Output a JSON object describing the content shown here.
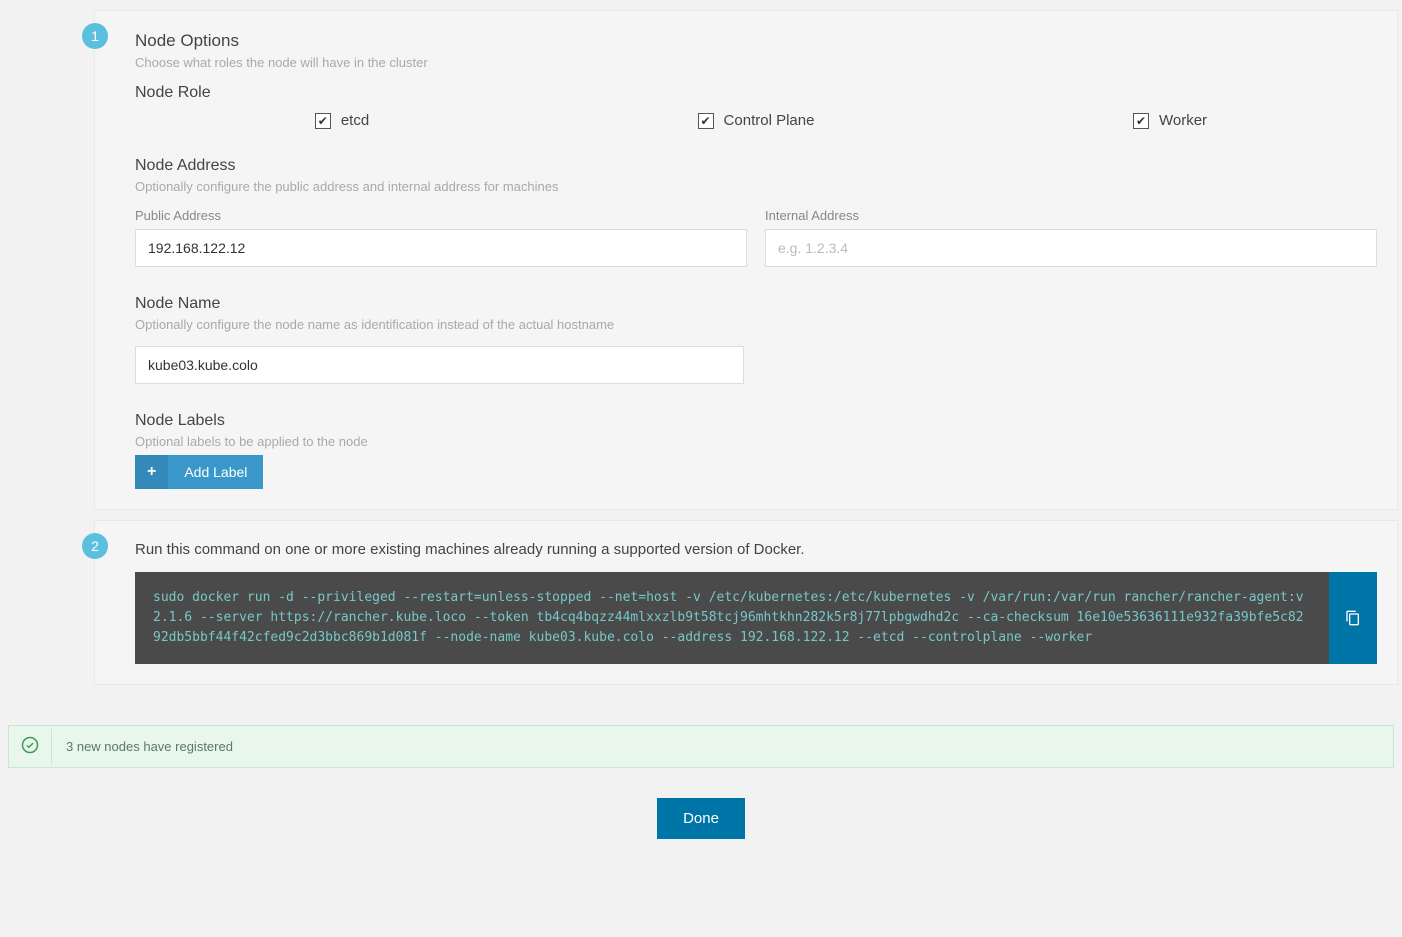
{
  "step1": {
    "badge": "1",
    "title": "Node Options",
    "desc": "Choose what roles the node will have in the cluster",
    "role": {
      "title": "Node Role",
      "etcd": "etcd",
      "control_plane": "Control Plane",
      "worker": "Worker"
    },
    "address": {
      "title": "Node Address",
      "desc": "Optionally configure the public address and internal address for machines",
      "public_label": "Public Address",
      "public_value": "192.168.122.12",
      "internal_label": "Internal Address",
      "internal_placeholder": "e.g. 1.2.3.4"
    },
    "name": {
      "title": "Node Name",
      "desc": "Optionally configure the node name as identification instead of the actual hostname",
      "value": "kube03.kube.colo"
    },
    "labels": {
      "title": "Node Labels",
      "desc": "Optional labels to be applied to the node",
      "add_btn": "Add Label"
    }
  },
  "step2": {
    "badge": "2",
    "title": "Run this command on one or more existing machines already running a supported version of Docker.",
    "command": "sudo docker run -d --privileged --restart=unless-stopped --net=host -v /etc/kubernetes:/etc/kubernetes -v /var/run:/var/run rancher/rancher-agent:v2.1.6 --server https://rancher.kube.loco --token tb4cq4bqzz44mlxxzlb9t58tcj96mhtkhn282k5r8j77lpbgwdhd2c --ca-checksum 16e10e53636111e932fa39bfe5c8292db5bbf44f42cfed9c2d3bbc869b1d081f --node-name kube03.kube.colo --address 192.168.122.12 --etcd --controlplane --worker"
  },
  "banner": {
    "text": "3 new nodes have registered"
  },
  "done": "Done"
}
